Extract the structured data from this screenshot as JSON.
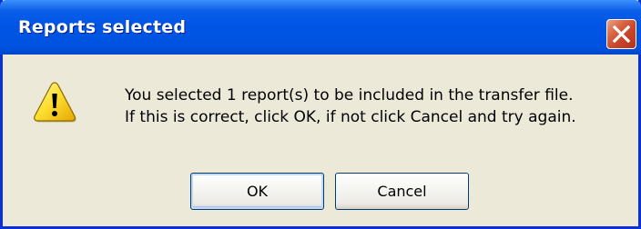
{
  "window": {
    "title": "Reports selected",
    "close_icon": "close-icon"
  },
  "dialog": {
    "icon": "warning-icon",
    "message_line1": "You selected 1 report(s) to be included in the transfer file.",
    "message_line2": "If this is correct, click OK, if not click Cancel and try again."
  },
  "buttons": {
    "ok_label": "OK",
    "cancel_label": "Cancel"
  },
  "colors": {
    "titlebar": "#0054E3",
    "window_bg": "#ECE9D8",
    "close_button": "#C8452A",
    "warning_yellow": "#FFE033"
  }
}
